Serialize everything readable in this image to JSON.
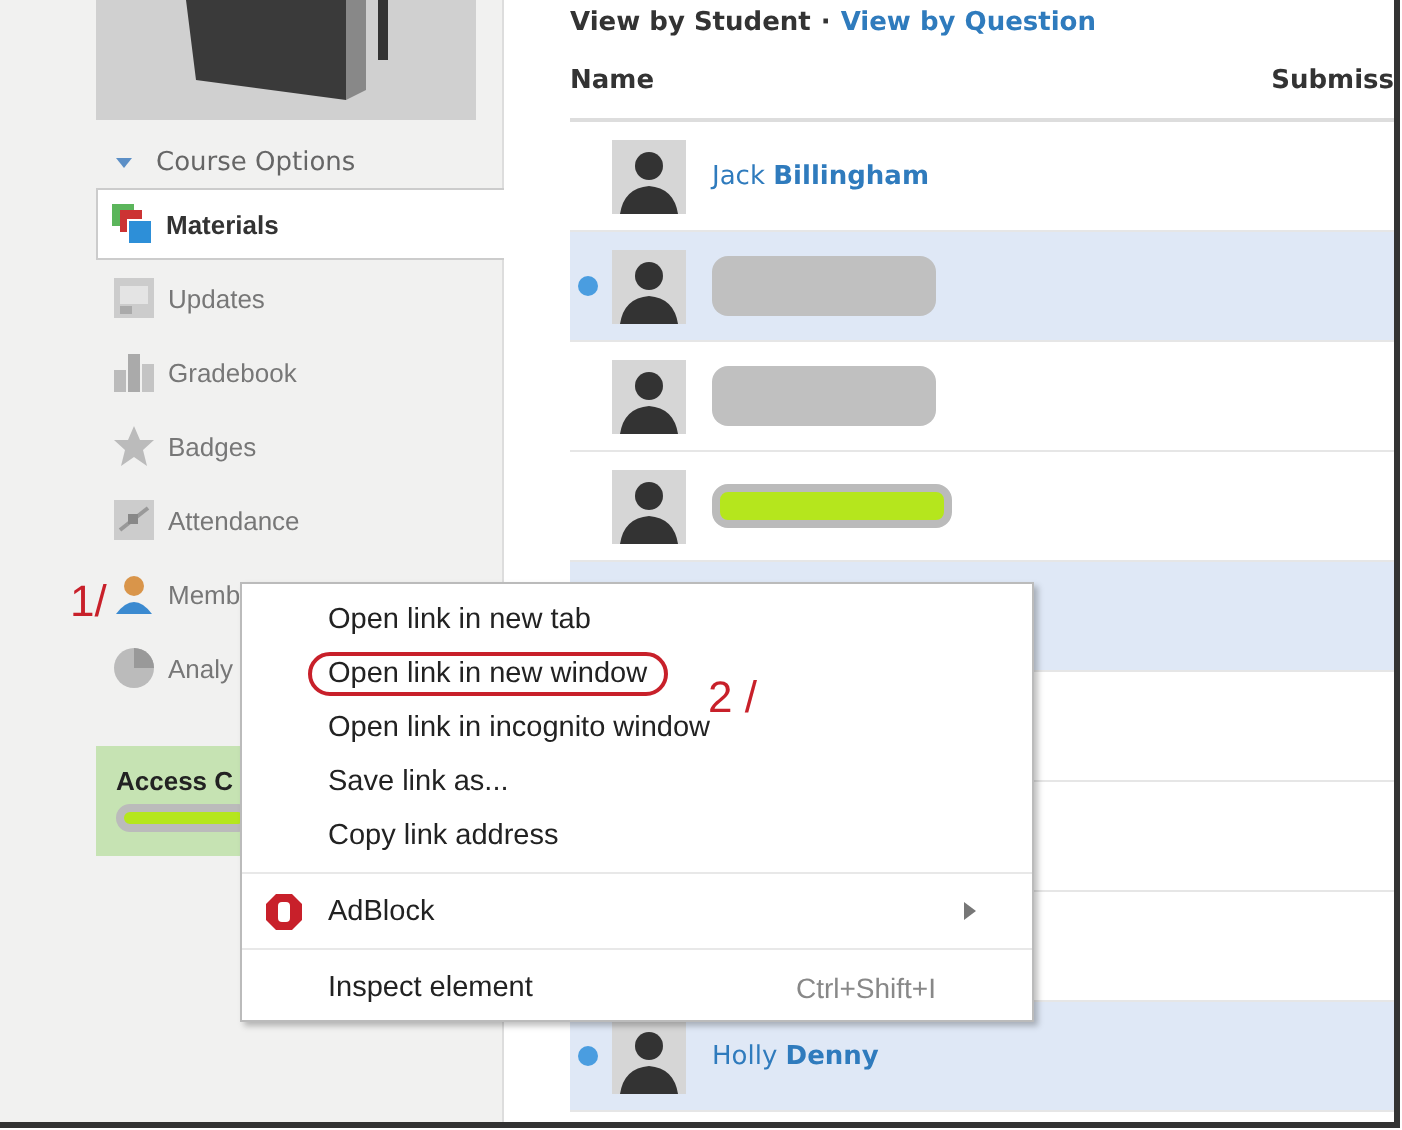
{
  "sidebar": {
    "course_options": "Course Options",
    "items": [
      {
        "label": "Materials",
        "kind": "materials",
        "selected": true
      },
      {
        "label": "Updates",
        "kind": "updates",
        "selected": false
      },
      {
        "label": "Gradebook",
        "kind": "gradebook",
        "selected": false
      },
      {
        "label": "Badges",
        "kind": "badges",
        "selected": false
      },
      {
        "label": "Attendance",
        "kind": "attendance",
        "selected": false
      },
      {
        "label": "Memb",
        "kind": "members",
        "selected": false
      },
      {
        "label": "Analy",
        "kind": "analytics",
        "selected": false
      }
    ],
    "access_code": {
      "label": "Access C",
      "kind": "redacted_highlight"
    }
  },
  "view_switch": {
    "current": "View by Student",
    "separator": "·",
    "link": "View by Question"
  },
  "table": {
    "columns": [
      "Name",
      "Submiss"
    ],
    "rows": [
      {
        "kind": "named",
        "first": "Jack",
        "last": "Billingham",
        "unread": false
      },
      {
        "kind": "redacted_grey",
        "unread": true
      },
      {
        "kind": "redacted_grey",
        "unread": false
      },
      {
        "kind": "redacted_highlight",
        "unread": false
      },
      {
        "kind": "covered",
        "unread": true
      },
      {
        "kind": "covered",
        "unread": false
      },
      {
        "kind": "covered",
        "unread": false
      },
      {
        "kind": "covered",
        "unread": false
      },
      {
        "kind": "named",
        "first": "Holly",
        "last": "Denny",
        "unread": true
      }
    ]
  },
  "context_menu": {
    "items": [
      {
        "kind": "item",
        "label": "Open link in new tab",
        "circled": false
      },
      {
        "kind": "item",
        "label": "Open link in new window",
        "circled": true
      },
      {
        "kind": "item",
        "label": "Open link in incognito window",
        "circled": false
      },
      {
        "kind": "item",
        "label": "Save link as...",
        "circled": false
      },
      {
        "kind": "item",
        "label": "Copy link address",
        "circled": false
      },
      {
        "kind": "separator"
      },
      {
        "kind": "extension",
        "label": "AdBlock",
        "submenu": true
      },
      {
        "kind": "separator"
      },
      {
        "kind": "item",
        "label": "Inspect element",
        "shortcut": "Ctrl+Shift+I",
        "circled": false
      }
    ]
  },
  "annotations": [
    "1/",
    "2 /"
  ]
}
